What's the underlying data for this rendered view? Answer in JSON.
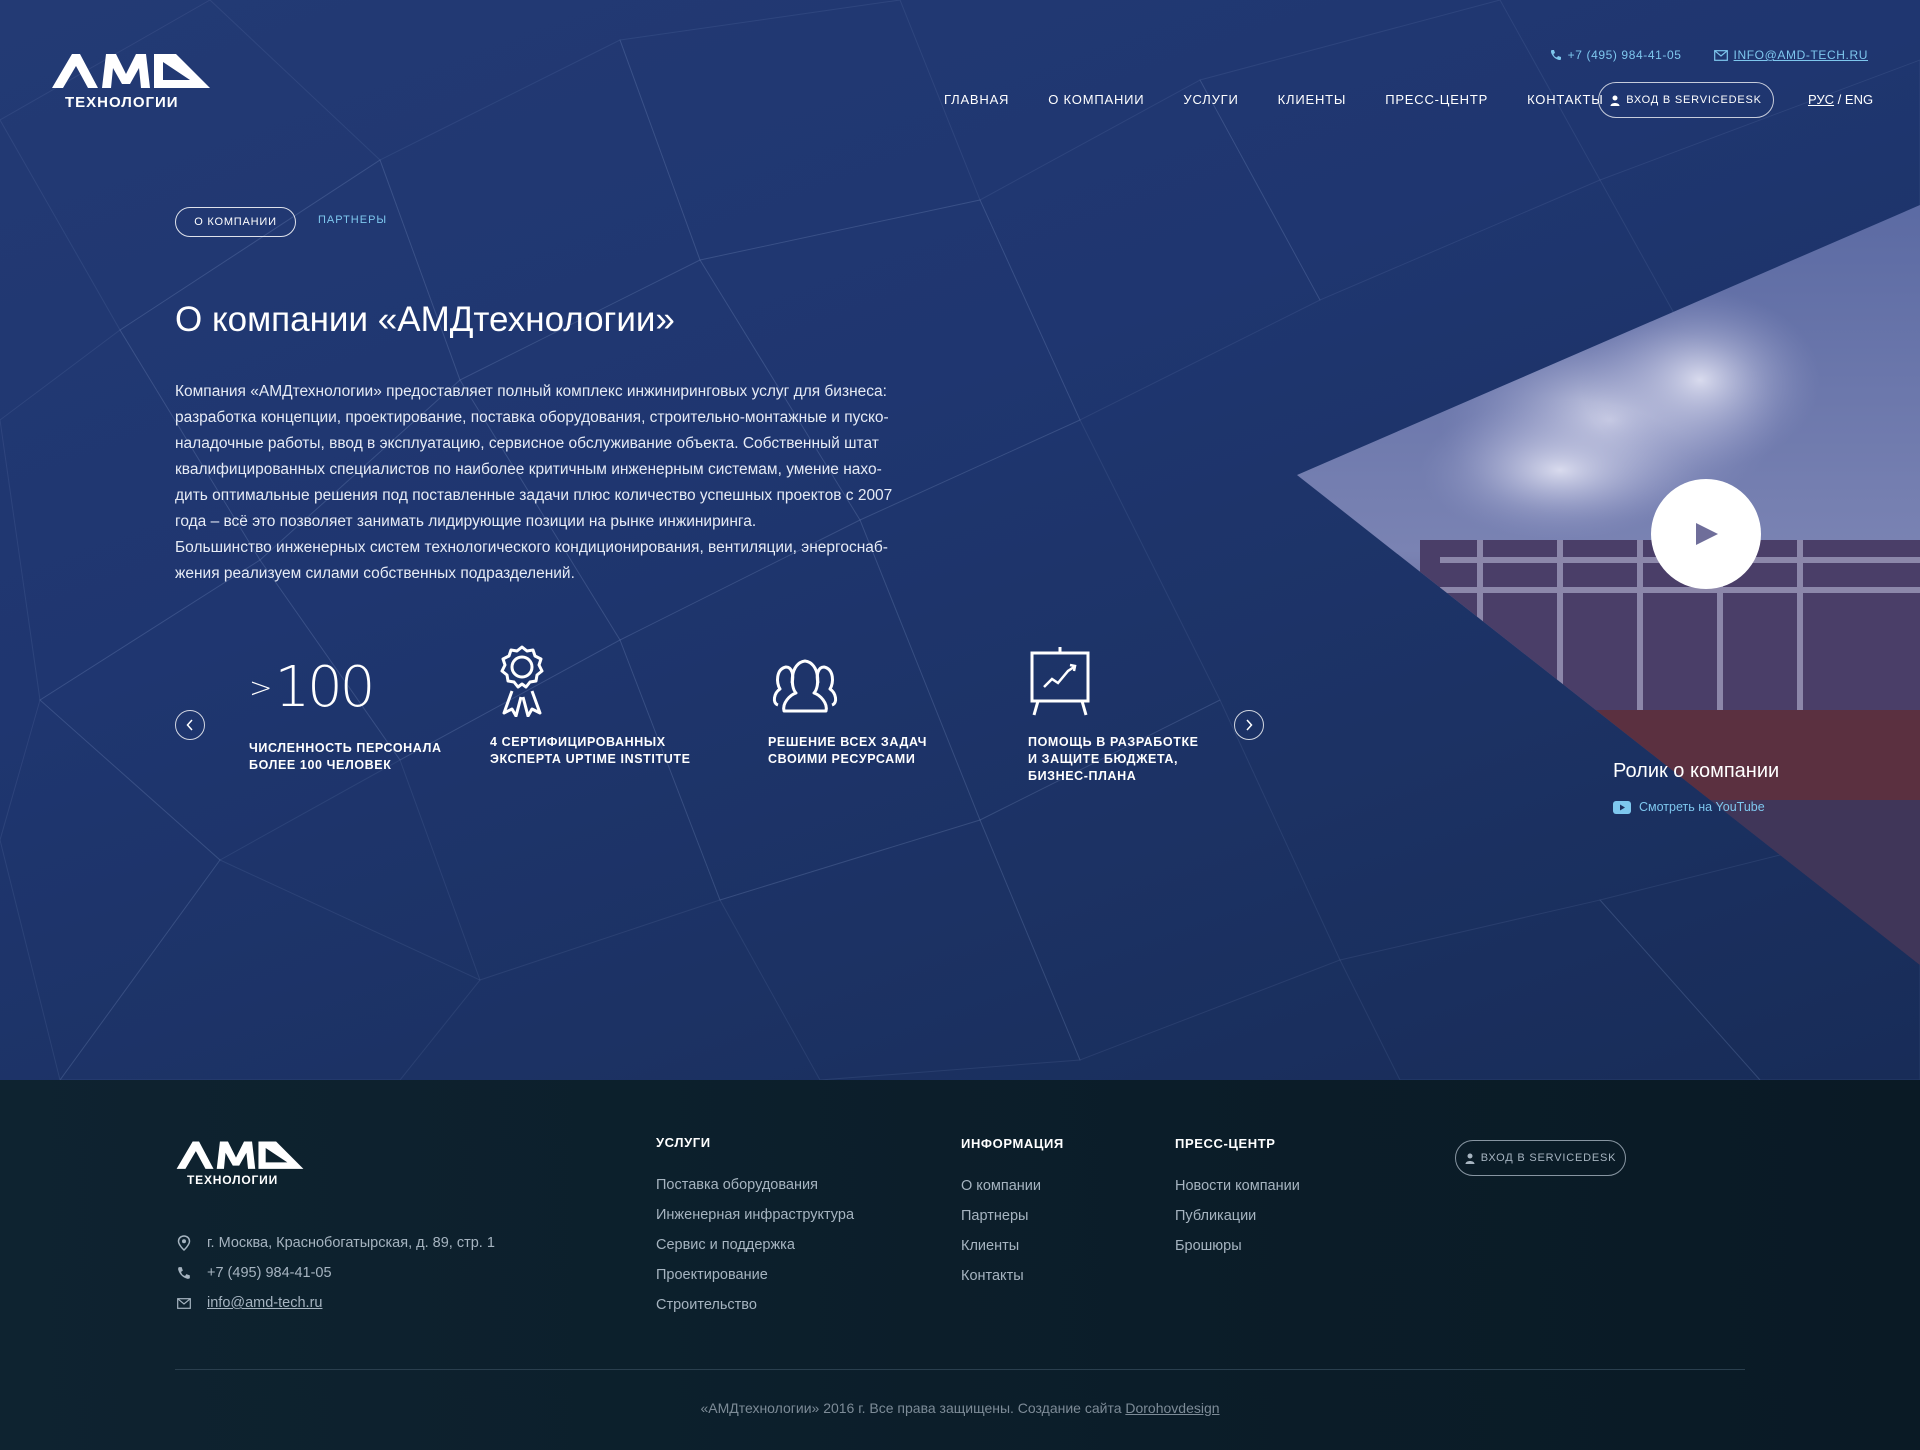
{
  "header": {
    "logo_text": "AMD",
    "logo_sub": "ТЕХНОЛОГИИ",
    "phone": "+7 (495) 984-41-05",
    "email": "INFO@AMD-TECH.RU",
    "nav": [
      {
        "label": "ГЛАВНАЯ"
      },
      {
        "label": "О КОМПАНИИ"
      },
      {
        "label": "УСЛУГИ"
      },
      {
        "label": "КЛИЕНТЫ"
      },
      {
        "label": "ПРЕСС-ЦЕНТР"
      },
      {
        "label": "КОНТАКТЫ"
      }
    ],
    "servicedesk_label": "ВХОД В SERVICEDESK",
    "lang_ru": "РУС",
    "lang_sep": "/",
    "lang_en": "ENG"
  },
  "subnav": {
    "active_tab": "О КОМПАНИИ",
    "other_tab": "ПАРТНЕРЫ"
  },
  "main": {
    "title": "О компании «АМДтехнологии»",
    "intro_lines": [
      "Компания «АМДтехнологии» предоставляет полный комплекс инжиниринговых услуг для бизнеса:",
      "разработка концепции, проектирование, поставка оборудования, строительно-монтажные и пуско-",
      "наладочные работы, ввод в эксплуатацию, сервисное обслуживание объекта. Собственный штат",
      "квалифицированных специалистов по наиболее критичным инженерным системам, умение нахо-",
      "дить оптимальные решения под поставленные задачи плюс количество успешных проектов с 2007",
      "года – всё это позволяет занимать лидирующие позиции на рынке инжиниринга.",
      "Большинство инженерных систем технологического кондиционирования, вентиляции, энергоснаб-",
      "жения реализуем силами собственных подразделений."
    ],
    "stats": [
      {
        "prefix": ">",
        "value": "100",
        "lines": [
          "ЧИСЛЕННОСТЬ ПЕРСОНАЛА",
          "БОЛЕЕ 100 ЧЕЛОВЕК"
        ]
      },
      {
        "icon": "award-ribbon-icon",
        "lines": [
          "4 СЕРТИФИЦИРОВАННЫХ",
          "ЭКСПЕРТА UPTIME INSTITUTE"
        ]
      },
      {
        "icon": "team-people-icon",
        "lines": [
          "РЕШЕНИЕ ВСЕХ ЗАДАЧ",
          "СВОИМИ РЕСУРСАМИ"
        ]
      },
      {
        "icon": "chart-easel-icon",
        "lines": [
          "ПОМОЩЬ В РАЗРАБОТКЕ",
          "И ЗАЩИТЕ БЮДЖЕТА,",
          "БИЗНЕС-ПЛАНА"
        ]
      }
    ],
    "video": {
      "title": "Ролик о компании",
      "link": "Смотреть на YouTube"
    }
  },
  "footer": {
    "logo_text": "AMD",
    "logo_sub": "ТЕХНОЛОГИИ",
    "address": "г. Москва, Краснобогатырская, д. 89, стр. 1",
    "phone": "+7 (495) 984-41-05",
    "email": "info@amd-tech.ru",
    "columns": [
      {
        "title": "УСЛУГИ",
        "links": [
          "Поставка оборудования",
          "Инженерная инфраструктура",
          "Сервис и поддержка",
          "Проектирование",
          "Строительство"
        ]
      },
      {
        "title": "ИНФОРМАЦИЯ",
        "links": [
          "О компании",
          "Партнеры",
          "Клиенты",
          "Контакты"
        ]
      },
      {
        "title": "ПРЕСС-ЦЕНТР",
        "links": [
          "Новости компании",
          "Публикации",
          "Брошюры"
        ]
      }
    ],
    "servicedesk_label": "ВХОД В SERVICEDESK",
    "copyright": "«АМДтехнологии» 2016 г. Все права защищены. Создание сайта",
    "author": "Dorohovdesign"
  },
  "colors": {
    "hero_bg": "#1f3670",
    "accent_link": "#7ec7ee",
    "footer_bg": "#0b1d29",
    "footer_text": "#a6b4c0"
  }
}
